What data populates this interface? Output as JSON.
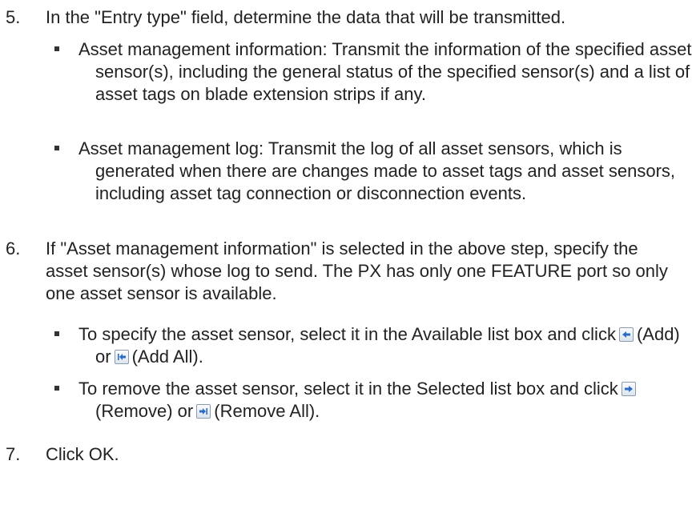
{
  "steps": [
    {
      "number": "5.",
      "text": "In the \"Entry type\" field, determine the data that will be transmitted.",
      "bullets": [
        "Asset management information: Transmit the information of the specified asset sensor(s), including the general status of the specified sensor(s) and a list of asset tags on blade extension strips if any.",
        "Asset management log: Transmit the log of all asset sensors, which is generated when there are changes made to asset tags and asset sensors, including asset tag connection or disconnection events."
      ]
    },
    {
      "number": "6.",
      "text": "If \"Asset management information\" is selected in the above step, specify the asset sensor(s) whose log to send. The PX has only one FEATURE port so only one asset sensor is available.",
      "bullets": [
        {
          "before": "To specify the asset sensor, select it in the Available list box and click",
          "button1_icon": "add-arrow-icon",
          "button1_label": "(Add) or",
          "button2_icon": "add-all-arrow-icon",
          "button2_label": "(Add All)."
        },
        {
          "before": "To remove the asset sensor, select it in the Selected list box and click",
          "button1_icon": "remove-arrow-icon",
          "button1_label": "(Remove) or",
          "button2_icon": "remove-all-arrow-icon",
          "button2_label": "(Remove All)."
        }
      ]
    },
    {
      "number": "7.",
      "text": "Click OK."
    }
  ],
  "colors": {
    "text": "#222222",
    "icon_arrow": "#2b6cc4"
  }
}
